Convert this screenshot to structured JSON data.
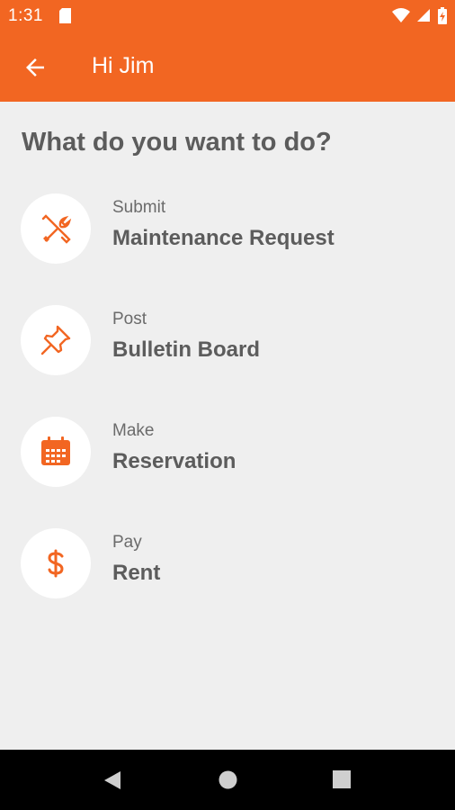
{
  "status_bar": {
    "time": "1:31"
  },
  "app_bar": {
    "title": "Hi Jim"
  },
  "heading": "What do you want to do?",
  "actions": [
    {
      "small": "Submit",
      "big": "Maintenance Request",
      "icon": "tools-icon"
    },
    {
      "small": "Post",
      "big": "Bulletin Board",
      "icon": "pushpin-icon"
    },
    {
      "small": "Make",
      "big": "Reservation",
      "icon": "calendar-icon"
    },
    {
      "small": "Pay",
      "big": "Rent",
      "icon": "dollar-icon"
    }
  ],
  "colors": {
    "primary": "#f26622",
    "background": "#efefef",
    "text": "#5c5c5c"
  }
}
